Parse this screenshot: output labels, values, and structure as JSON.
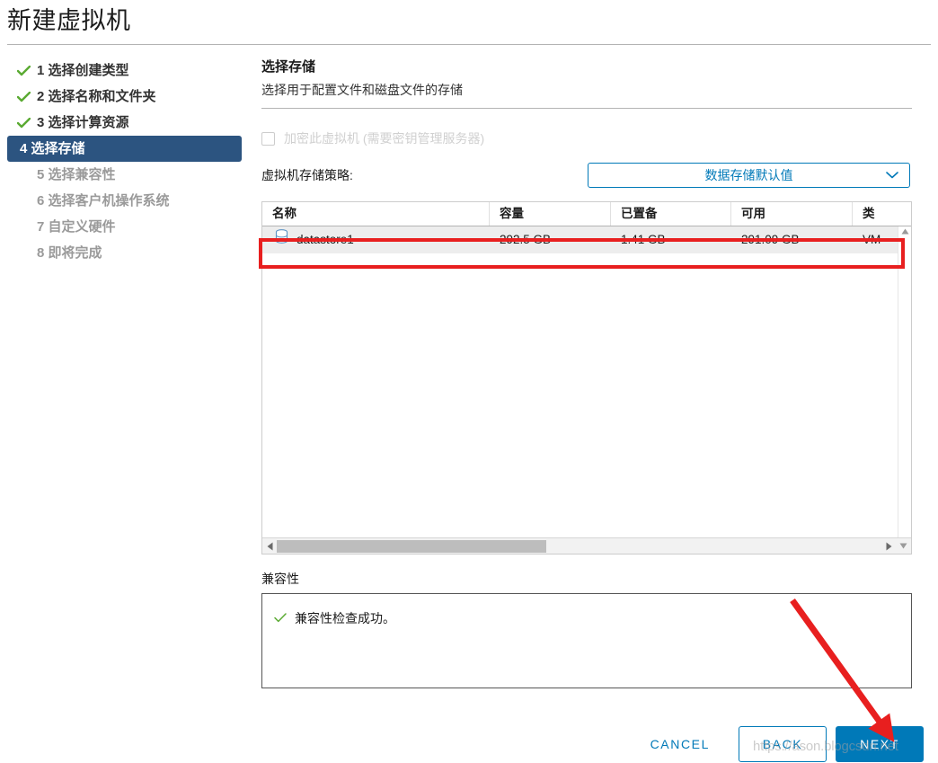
{
  "wizard": {
    "title": "新建虚拟机"
  },
  "steps": [
    {
      "num": "1",
      "label": "1 选择创建类型",
      "state": "done",
      "icon": "check-icon"
    },
    {
      "num": "2",
      "label": "2 选择名称和文件夹",
      "state": "done",
      "icon": "check-icon"
    },
    {
      "num": "3",
      "label": "3 选择计算资源",
      "state": "done",
      "icon": "check-icon"
    },
    {
      "num": "4",
      "label": "4 选择存储",
      "state": "active",
      "icon": ""
    },
    {
      "num": "5",
      "label": "5 选择兼容性",
      "state": "pending",
      "icon": ""
    },
    {
      "num": "6",
      "label": "6 选择客户机操作系统",
      "state": "pending",
      "icon": ""
    },
    {
      "num": "7",
      "label": "7 自定义硬件",
      "state": "pending",
      "icon": ""
    },
    {
      "num": "8",
      "label": "8 即将完成",
      "state": "pending",
      "icon": ""
    }
  ],
  "pane": {
    "title": "选择存储",
    "subtitle": "选择用于配置文件和磁盘文件的存储"
  },
  "encrypt": {
    "label": "加密此虚拟机 (需要密钥管理服务器)",
    "checked": false,
    "disabled": true
  },
  "storage_policy": {
    "label": "虚拟机存储策略:",
    "selected": "数据存储默认值",
    "options": [
      "数据存储默认值"
    ]
  },
  "datastore_table": {
    "columns": [
      "名称",
      "容量",
      "已置备",
      "可用",
      "类型"
    ],
    "column_last_truncated": "类",
    "rows": [
      {
        "name": "datastore1",
        "capacity": "292.5 GB",
        "provisioned": "1.41 GB",
        "free": "291.09 GB",
        "type": "VM",
        "selected": true,
        "icon": "datastore-icon"
      }
    ]
  },
  "compatibility": {
    "label": "兼容性",
    "message": "兼容性检查成功。",
    "status_icon": "check-icon"
  },
  "footer": {
    "cancel_label": "CANCEL",
    "back_label": "BACK",
    "next_label": "NEXT"
  },
  "annotations": {
    "highlight_target": "datastore1-row",
    "arrow_target": "next-button",
    "arrow_color": "#e81f1f",
    "highlight_color": "#e81f1f"
  },
  "watermark": {
    "text": "https://ason.blogcsdn.net"
  },
  "colors": {
    "accent_blue": "#0079b8",
    "active_step_bg": "#2c5480",
    "check_green": "#5aaa32",
    "annotation_red": "#e81f1f",
    "row_selected_bg": "#ededed"
  }
}
